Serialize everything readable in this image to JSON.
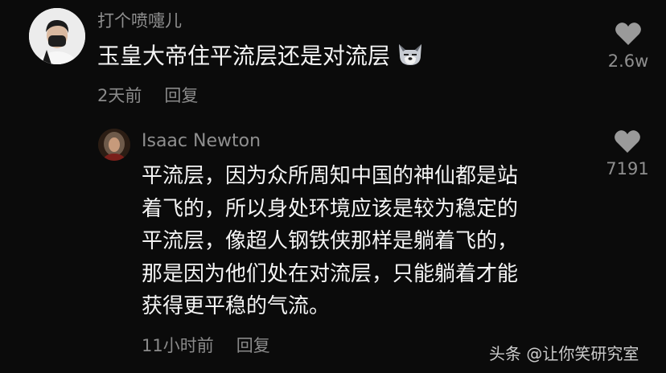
{
  "comment": {
    "username": "打个喷嚏儿",
    "text": "玉皇大帝住平流层还是对流层",
    "emoji": "wolf-face-emoji",
    "time": "2天前",
    "reply_label": "回复",
    "like_count": "2.6w"
  },
  "reply": {
    "username": "Isaac Newton",
    "lines": [
      "平流层，因为众所周知中国的神仙都是站",
      "着飞的，所以身处环境应该是较为稳定的",
      "平流层，像超人钢铁侠那样是躺着飞的，",
      "那是因为他们处在对流层，只能躺着才能",
      "获得更平稳的气流。"
    ],
    "time": "11小时前",
    "reply_label": "回复",
    "like_count": "7191"
  },
  "watermark": "头条 @让你笑研究室",
  "colors": {
    "background": "#0b0b0b",
    "primary_text": "#f4f4f4",
    "secondary_text": "#8f8f8f",
    "heart": "#9a9a9a"
  }
}
